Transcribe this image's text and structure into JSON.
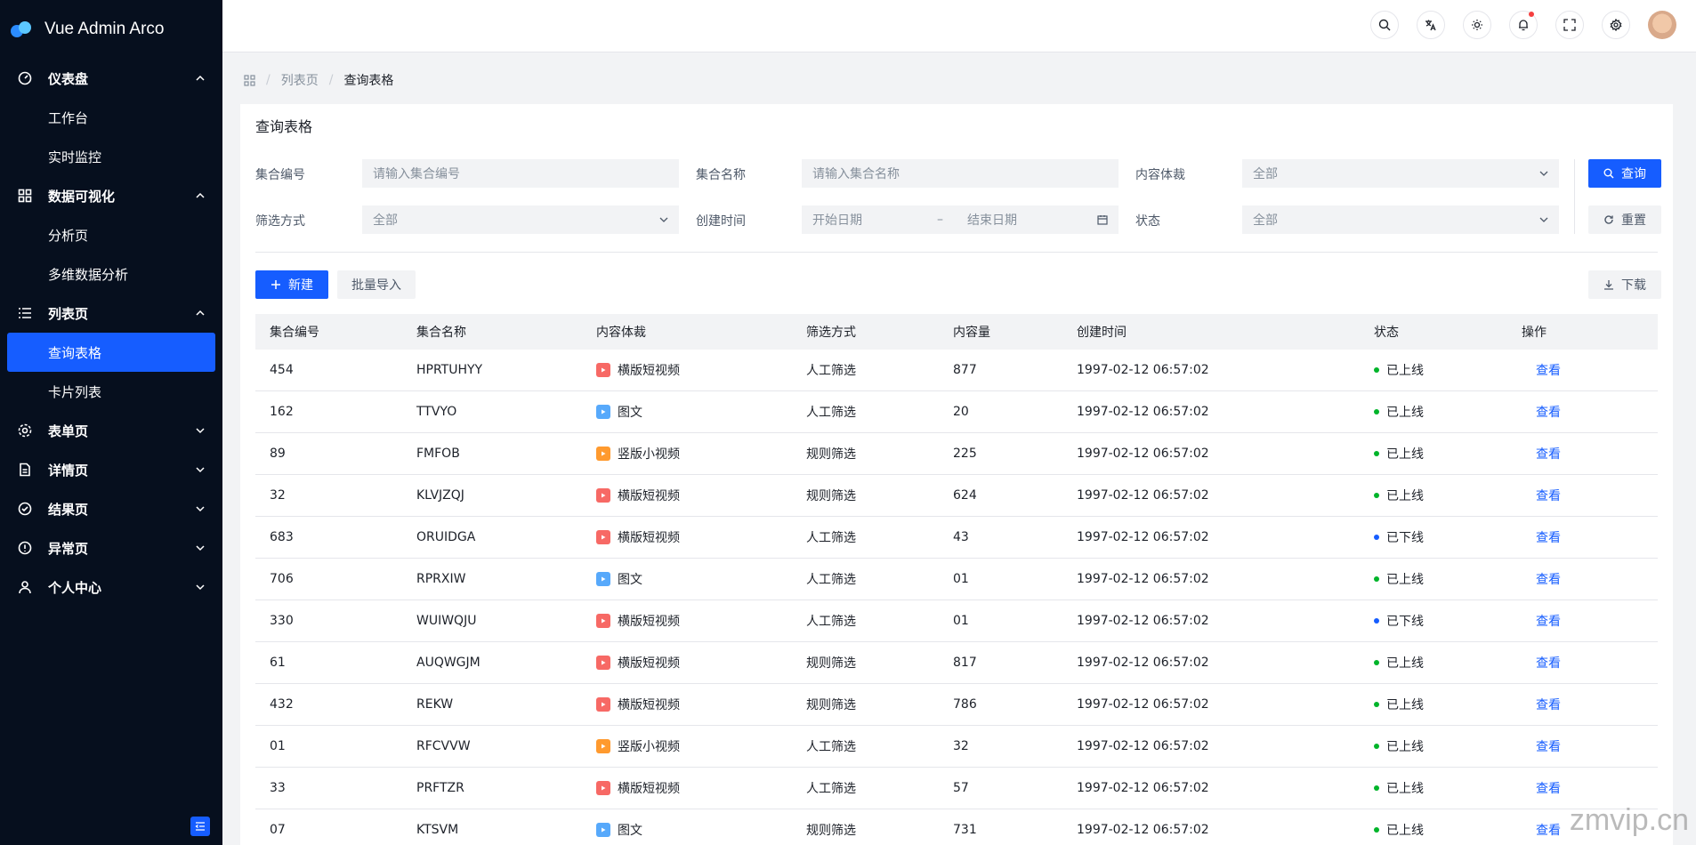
{
  "app": {
    "title": "Vue Admin Arco"
  },
  "sidebar": {
    "groups": [
      {
        "label": "仪表盘",
        "children": [
          "工作台",
          "实时监控"
        ]
      },
      {
        "label": "数据可视化",
        "children": [
          "分析页",
          "多维数据分析"
        ]
      },
      {
        "label": "列表页",
        "children": [
          "查询表格",
          "卡片列表"
        ]
      },
      {
        "label": "表单页"
      },
      {
        "label": "详情页"
      },
      {
        "label": "结果页"
      },
      {
        "label": "异常页"
      },
      {
        "label": "个人中心"
      }
    ]
  },
  "breadcrumb": {
    "level1": "列表页",
    "level2": "查询表格"
  },
  "page": {
    "title": "查询表格"
  },
  "filters": {
    "set_id_label": "集合编号",
    "set_id_placeholder": "请输入集合编号",
    "set_name_label": "集合名称",
    "set_name_placeholder": "请输入集合名称",
    "content_type_label": "内容体裁",
    "content_type_value": "全部",
    "filter_type_label": "筛选方式",
    "filter_type_value": "全部",
    "created_label": "创建时间",
    "start_placeholder": "开始日期",
    "range_sep": "–",
    "end_placeholder": "结束日期",
    "status_label": "状态",
    "status_value": "全部",
    "search_button": "查询",
    "reset_button": "重置"
  },
  "toolbar": {
    "new_button": "新建",
    "import_button": "批量导入",
    "download_button": "下载"
  },
  "table": {
    "columns": [
      "集合编号",
      "集合名称",
      "内容体裁",
      "筛选方式",
      "内容量",
      "创建时间",
      "状态",
      "操作"
    ],
    "action_label": "查看",
    "rows": [
      {
        "id": "454",
        "name": "HPRTUHYY",
        "type": "横版短视频",
        "filter": "人工筛选",
        "count": "877",
        "created": "1997-02-12 06:57:02",
        "status": "已上线"
      },
      {
        "id": "162",
        "name": "TTVYO",
        "type": "图文",
        "filter": "人工筛选",
        "count": "20",
        "created": "1997-02-12 06:57:02",
        "status": "已上线"
      },
      {
        "id": "89",
        "name": "FMFOB",
        "type": "竖版小视频",
        "filter": "规则筛选",
        "count": "225",
        "created": "1997-02-12 06:57:02",
        "status": "已上线"
      },
      {
        "id": "32",
        "name": "KLVJZQJ",
        "type": "横版短视频",
        "filter": "规则筛选",
        "count": "624",
        "created": "1997-02-12 06:57:02",
        "status": "已上线"
      },
      {
        "id": "683",
        "name": "ORUIDGA",
        "type": "横版短视频",
        "filter": "人工筛选",
        "count": "43",
        "created": "1997-02-12 06:57:02",
        "status": "已下线"
      },
      {
        "id": "706",
        "name": "RPRXIW",
        "type": "图文",
        "filter": "人工筛选",
        "count": "01",
        "created": "1997-02-12 06:57:02",
        "status": "已上线"
      },
      {
        "id": "330",
        "name": "WUIWQJU",
        "type": "横版短视频",
        "filter": "人工筛选",
        "count": "01",
        "created": "1997-02-12 06:57:02",
        "status": "已下线"
      },
      {
        "id": "61",
        "name": "AUQWGJM",
        "type": "横版短视频",
        "filter": "规则筛选",
        "count": "817",
        "created": "1997-02-12 06:57:02",
        "status": "已上线"
      },
      {
        "id": "432",
        "name": "REKW",
        "type": "横版短视频",
        "filter": "规则筛选",
        "count": "786",
        "created": "1997-02-12 06:57:02",
        "status": "已上线"
      },
      {
        "id": "01",
        "name": "RFCVVW",
        "type": "竖版小视频",
        "filter": "人工筛选",
        "count": "32",
        "created": "1997-02-12 06:57:02",
        "status": "已上线"
      },
      {
        "id": "33",
        "name": "PRFTZR",
        "type": "横版短视频",
        "filter": "人工筛选",
        "count": "57",
        "created": "1997-02-12 06:57:02",
        "status": "已上线"
      },
      {
        "id": "07",
        "name": "KTSVM",
        "type": "图文",
        "filter": "规则筛选",
        "count": "731",
        "created": "1997-02-12 06:57:02",
        "status": "已上线"
      }
    ]
  },
  "colors": {
    "primary": "#165dff",
    "sidebar_bg": "#060f1e",
    "online": "#00b42a",
    "offline": "#165dff",
    "video_icon": "#f76965",
    "image_icon": "#57a9fb",
    "short_video_icon": "#ff9a2e"
  },
  "watermark": "zmvip.cn"
}
